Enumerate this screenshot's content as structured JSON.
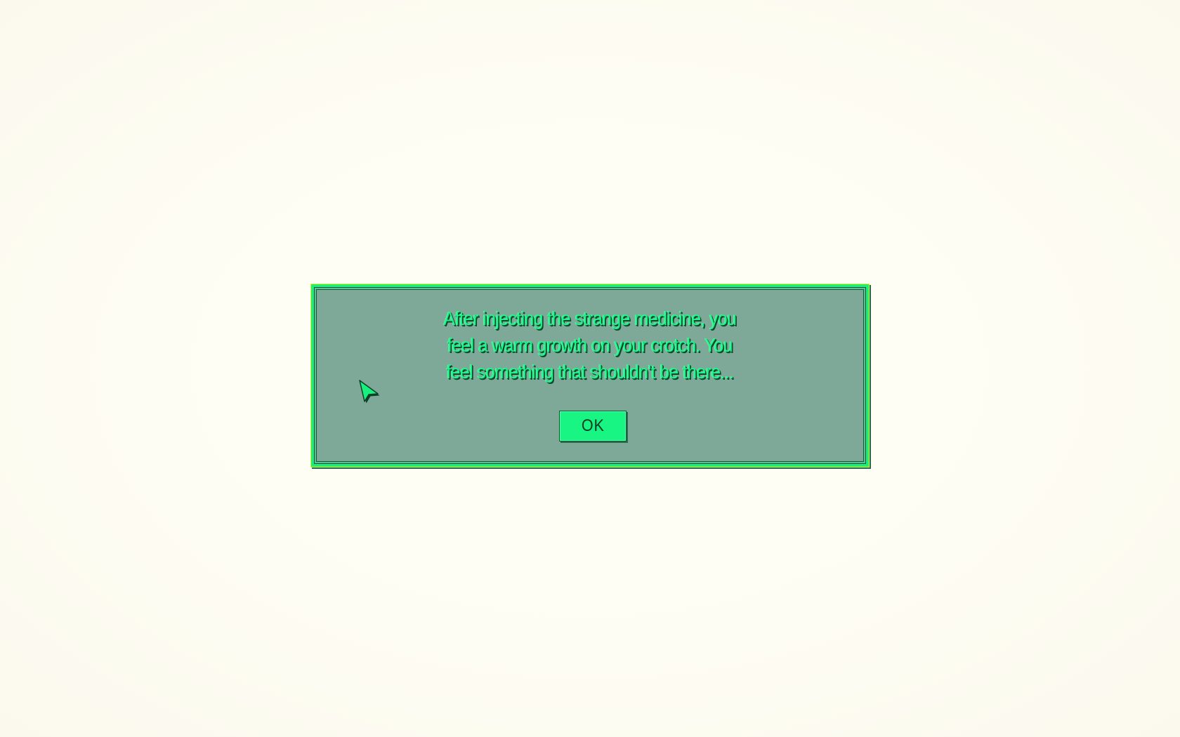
{
  "dialog": {
    "message_lines": [
      "After injecting the strange medicine, you",
      "feel a warm growth on your crotch. You",
      "feel something that shouldn't be there..."
    ],
    "ok_label": "OK"
  },
  "colors": {
    "accent_green": "#17f07e",
    "panel": "#7ea998",
    "background": "#fefdf3"
  },
  "icons": {
    "cursor": "pointer-cursor-icon"
  }
}
